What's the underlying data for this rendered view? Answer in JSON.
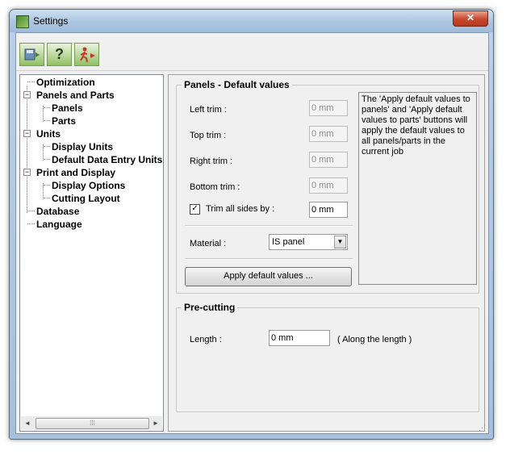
{
  "window": {
    "title": "Settings"
  },
  "toolbar": {
    "buttons": [
      {
        "icon": "save-disk-icon"
      },
      {
        "icon": "help-question-icon",
        "glyph": "?"
      },
      {
        "icon": "exit-runner-icon"
      }
    ]
  },
  "tree": {
    "items": [
      {
        "label": "Optimization",
        "level": 0
      },
      {
        "label": "Panels and Parts",
        "level": 0
      },
      {
        "label": "Panels",
        "level": 1
      },
      {
        "label": "Parts",
        "level": 1
      },
      {
        "label": "Units",
        "level": 0
      },
      {
        "label": "Display Units",
        "level": 1
      },
      {
        "label": "Default Data Entry Units",
        "level": 1
      },
      {
        "label": "Print and Display",
        "level": 0
      },
      {
        "label": "Display Options",
        "level": 1
      },
      {
        "label": "Cutting Layout",
        "level": 1
      },
      {
        "label": "Database",
        "level": 0
      },
      {
        "label": "Language",
        "level": 0
      }
    ]
  },
  "panels_defaults": {
    "title": "Panels - Default values",
    "left_trim_label": "Left trim :",
    "left_trim_value": "0 mm",
    "top_trim_label": "Top trim :",
    "top_trim_value": "0 mm",
    "right_trim_label": "Right trim :",
    "right_trim_value": "0 mm",
    "bottom_trim_label": "Bottom trim :",
    "bottom_trim_value": "0 mm",
    "trim_all_label": "Trim all sides by :",
    "trim_all_checked": true,
    "trim_all_value": "0 mm",
    "material_label": "Material :",
    "material_value": "IS panel",
    "apply_button": "Apply default values ...",
    "info_text": "The 'Apply default values to panels' and 'Apply default values to parts' buttons will apply the default values to all panels/parts in the current job"
  },
  "precutting": {
    "title": "Pre-cutting",
    "length_label": "Length :",
    "length_value": "0 mm",
    "length_hint": "( Along the length )"
  },
  "colors": {
    "toolbar_green": "#8fbf63",
    "close_red": "#c7452a"
  }
}
